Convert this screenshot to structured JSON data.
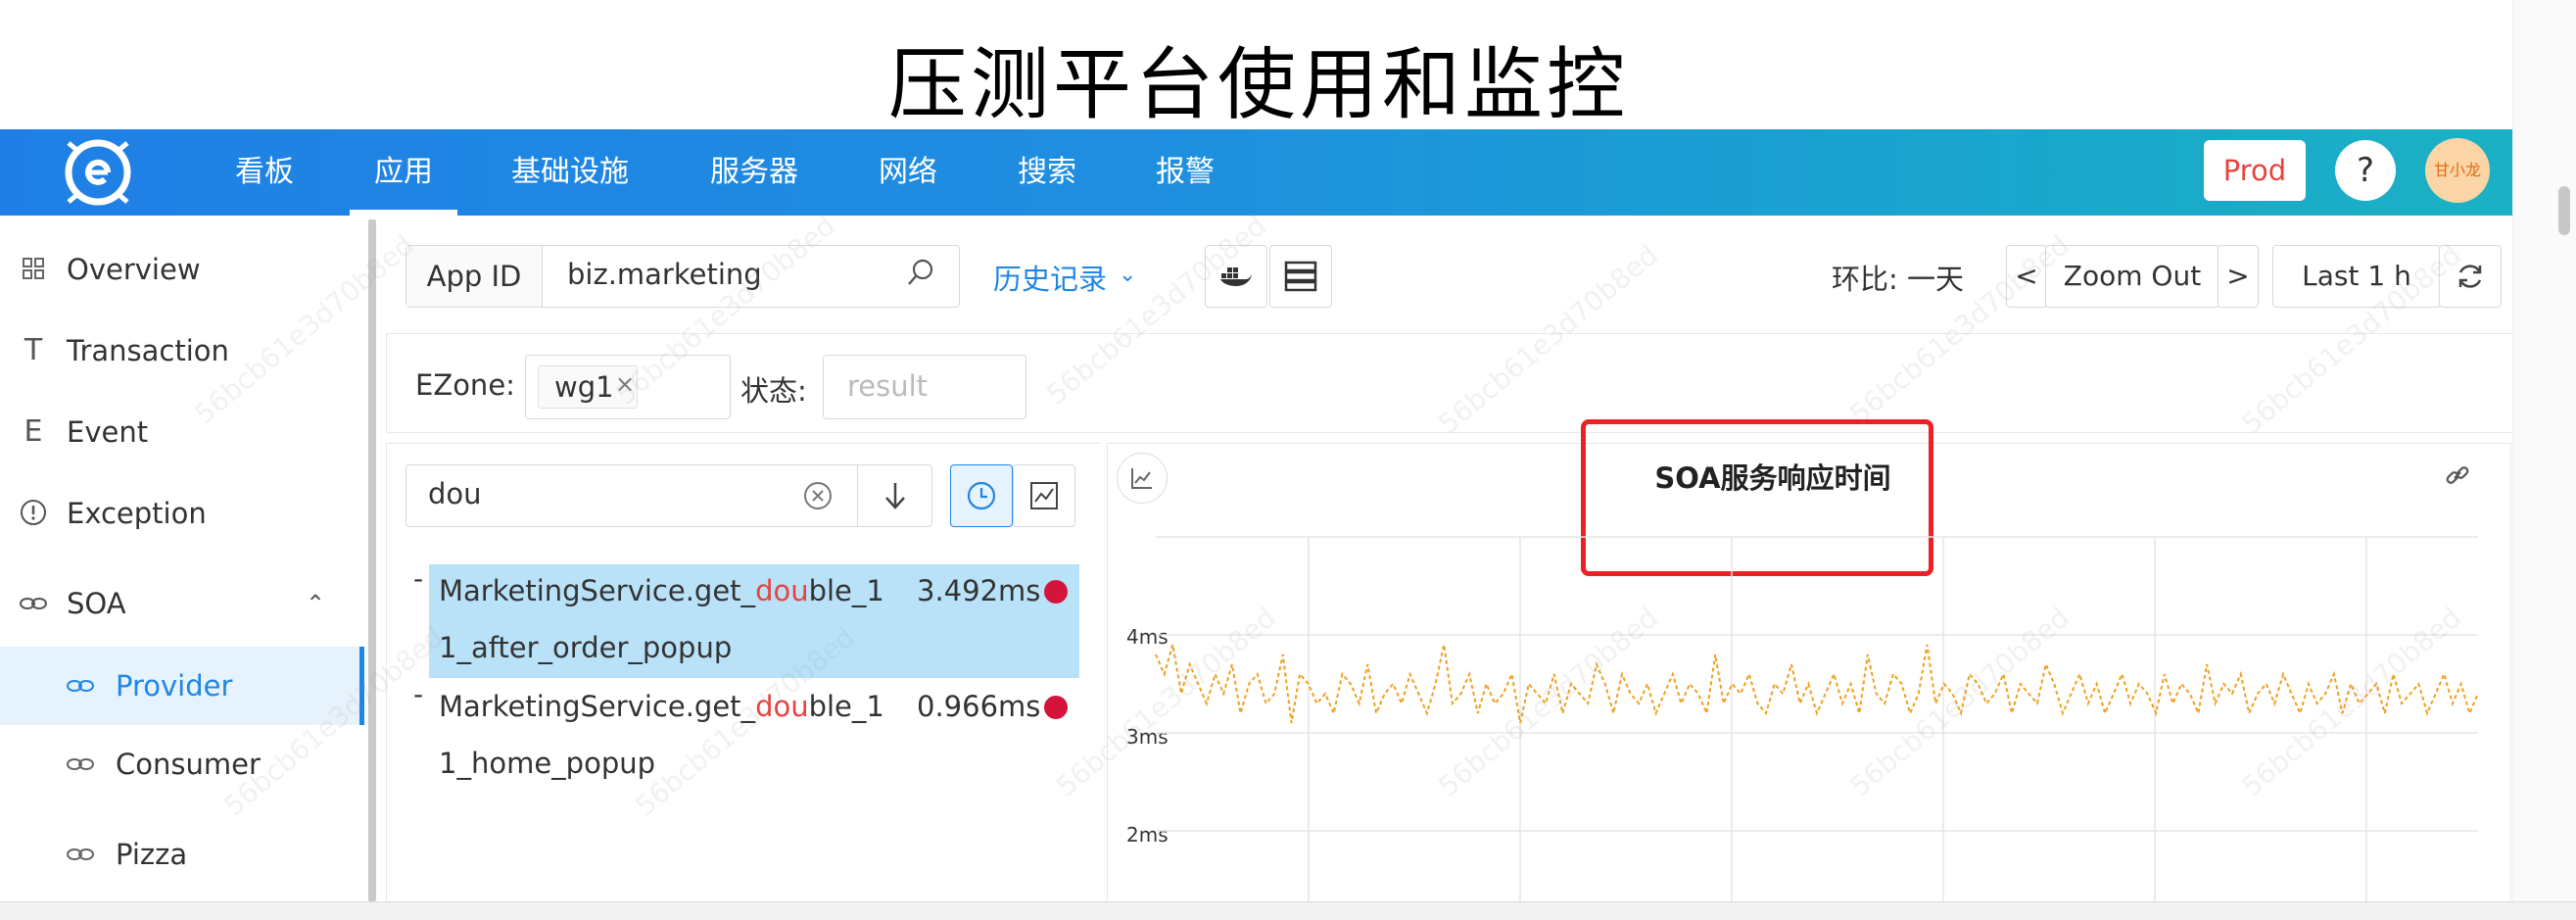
{
  "slide_title": "压测平台使用和监控",
  "nav": {
    "items": [
      "看板",
      "应用",
      "基础设施",
      "服务器",
      "网络",
      "搜索",
      "报警"
    ],
    "active": "应用",
    "env_button": "Prod",
    "help_label": "?",
    "user": "甘小龙"
  },
  "sidebar": {
    "items": [
      {
        "label": "Overview",
        "icon": "grid-icon"
      },
      {
        "label": "Transaction",
        "icon": "t-icon"
      },
      {
        "label": "Event",
        "icon": "e-icon"
      },
      {
        "label": "Exception",
        "icon": "alert-circle-icon"
      },
      {
        "label": "SOA",
        "icon": "link-icon",
        "expanded": true
      }
    ],
    "sub_items": [
      {
        "label": "Provider",
        "selected": true
      },
      {
        "label": "Consumer"
      },
      {
        "label": "Pizza"
      }
    ]
  },
  "toolbar": {
    "app_id_label": "App ID",
    "app_id_value": "biz.marketing",
    "history_label": "历史记录",
    "compare_label": "环比: 一天",
    "zoom_prev": "<",
    "zoom_label": "Zoom Out",
    "zoom_next": ">",
    "range_label": "Last 1 h"
  },
  "filters": {
    "ezone_label": "EZone:",
    "ezone_tag": "wg1",
    "status_label": "状态:",
    "status_placeholder": "result"
  },
  "search": {
    "value": "dou"
  },
  "results": [
    {
      "prefix": "MarketingService.get_",
      "match": "dou",
      "suffix": "ble_1",
      "line2": "1_after_order_popup",
      "time": "3.492ms",
      "selected": true
    },
    {
      "prefix": "MarketingService.get_",
      "match": "dou",
      "suffix": "ble_1",
      "line2": "1_home_popup",
      "time": "0.966ms",
      "selected": false
    }
  ],
  "chart_data": {
    "type": "line",
    "title": "SOA服务响应时间",
    "yticks": [
      "4ms",
      "3ms",
      "2ms"
    ],
    "series_color": "#f0a020",
    "y_range_ms": [
      2,
      4
    ],
    "series": [
      {
        "values": [
          3.8,
          3.6,
          3.9,
          3.4,
          3.7,
          3.5,
          3.3,
          3.6,
          3.4,
          3.7,
          3.2,
          3.5,
          3.6,
          3.3,
          3.4,
          3.8,
          3.1,
          3.6,
          3.5,
          3.3,
          3.4,
          3.2,
          3.6,
          3.5,
          3.3,
          3.7,
          3.2,
          3.4,
          3.5,
          3.3,
          3.6,
          3.4,
          3.2,
          3.5,
          3.9,
          3.3,
          3.4,
          3.6,
          3.2,
          3.5,
          3.3,
          3.4,
          3.6,
          3.1,
          3.5,
          3.4,
          3.3,
          3.6,
          3.2,
          3.5,
          3.4,
          3.3,
          3.7,
          3.5,
          3.2,
          3.6,
          3.4,
          3.3,
          3.5,
          3.2,
          3.4,
          3.6,
          3.3,
          3.5,
          3.4,
          3.2,
          3.8,
          3.3,
          3.5,
          3.4,
          3.6,
          3.3,
          3.2,
          3.5,
          3.4,
          3.7,
          3.3,
          3.5,
          3.2,
          3.4,
          3.6,
          3.3,
          3.5,
          3.2,
          3.8,
          3.4,
          3.3,
          3.6,
          3.5,
          3.2,
          3.4,
          3.9,
          3.3,
          3.5,
          3.4,
          3.2,
          3.6,
          3.5,
          3.3,
          3.4,
          3.6,
          3.2,
          3.5,
          3.4,
          3.3,
          3.7,
          3.5,
          3.2,
          3.4,
          3.6,
          3.3,
          3.5,
          3.2,
          3.4,
          3.6,
          3.3,
          3.5,
          3.4,
          3.2,
          3.6,
          3.3,
          3.5,
          3.4,
          3.2,
          3.7,
          3.3,
          3.5,
          3.4,
          3.6,
          3.2,
          3.4,
          3.5,
          3.3,
          3.6,
          3.4,
          3.2,
          3.5,
          3.3,
          3.4,
          3.6,
          3.2,
          3.5,
          3.3,
          3.4,
          3.5,
          3.2,
          3.6,
          3.3,
          3.4,
          3.5,
          3.2,
          3.4,
          3.6,
          3.3,
          3.5,
          3.2,
          3.4
        ]
      }
    ]
  }
}
